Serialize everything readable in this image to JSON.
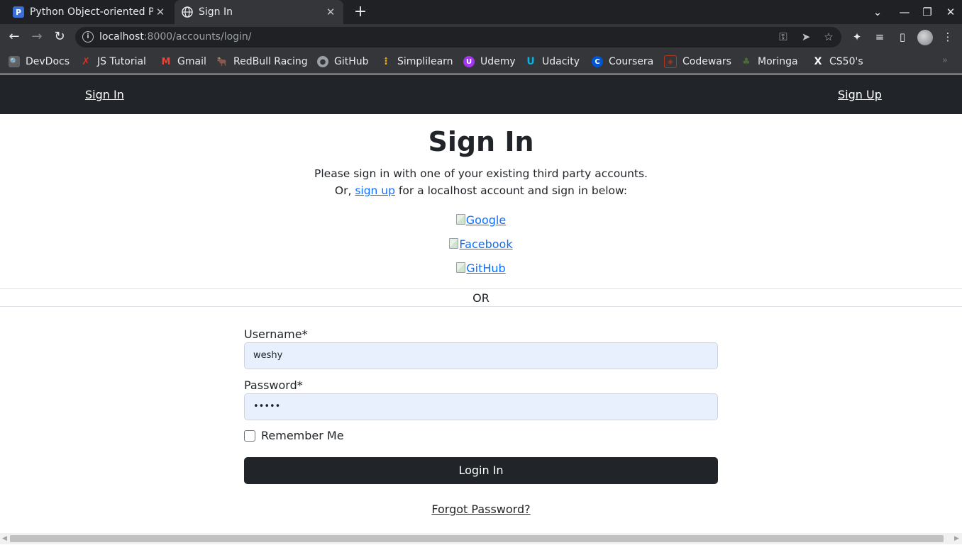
{
  "browser": {
    "tabs": [
      {
        "title": "Python Object-oriented P",
        "favicon": "P",
        "close": "✕"
      },
      {
        "title": "Sign In",
        "close": "✕"
      }
    ],
    "new_tab": "+",
    "window_controls": {
      "minimize": "—",
      "restore": "❐",
      "close": "✕",
      "dropdown": "⌄"
    },
    "url_host": "localhost",
    "url_rest": ":8000/accounts/login/",
    "bookmarks": [
      {
        "label": "DevDocs",
        "icon": "devdocs-icon",
        "color": "#5f6368"
      },
      {
        "label": "JS Tutorial",
        "icon": "js-tutorial-icon",
        "color": "#d93025"
      },
      {
        "label": "Gmail",
        "icon": "gmail-icon",
        "color": "#ea4335"
      },
      {
        "label": "RedBull Racing",
        "icon": "redbull-icon",
        "color": "#db0a40"
      },
      {
        "label": "GitHub",
        "icon": "github-icon",
        "color": "#24292e"
      },
      {
        "label": "Simplilearn",
        "icon": "simplilearn-icon",
        "color": "#f4b400"
      },
      {
        "label": "Udemy",
        "icon": "udemy-icon",
        "color": "#a435f0"
      },
      {
        "label": "Udacity",
        "icon": "udacity-icon",
        "color": "#02b3e4"
      },
      {
        "label": "Coursera",
        "icon": "coursera-icon",
        "color": "#0056d2"
      },
      {
        "label": "Codewars",
        "icon": "codewars-icon",
        "color": "#b1361e"
      },
      {
        "label": "Moringa",
        "icon": "moringa-icon",
        "color": "#4a6b3a"
      },
      {
        "label": "CS50's",
        "icon": "cs50-icon",
        "color": "#111111"
      }
    ]
  },
  "navbar": {
    "sign_in": "Sign In",
    "sign_up": "Sign Up"
  },
  "page": {
    "title": "Sign In",
    "intro_line1": "Please sign in with one of your existing third party accounts.",
    "intro_or": "Or,",
    "intro_link": "sign up",
    "intro_rest": "for a localhost account and sign in below:",
    "providers": [
      "Google",
      "Facebook",
      "GitHub"
    ],
    "or_text": "OR"
  },
  "form": {
    "username_label": "Username*",
    "username_value": "weshy",
    "password_label": "Password*",
    "password_value": "•••••",
    "remember_label": "Remember Me",
    "remember_checked": false,
    "submit_label": "Login In",
    "forgot_label": "Forgot Password?"
  },
  "colors": {
    "navbar_bg": "#212529",
    "link": "#0d6efd",
    "input_bg": "#e8f0fe",
    "button_bg": "#212529"
  }
}
